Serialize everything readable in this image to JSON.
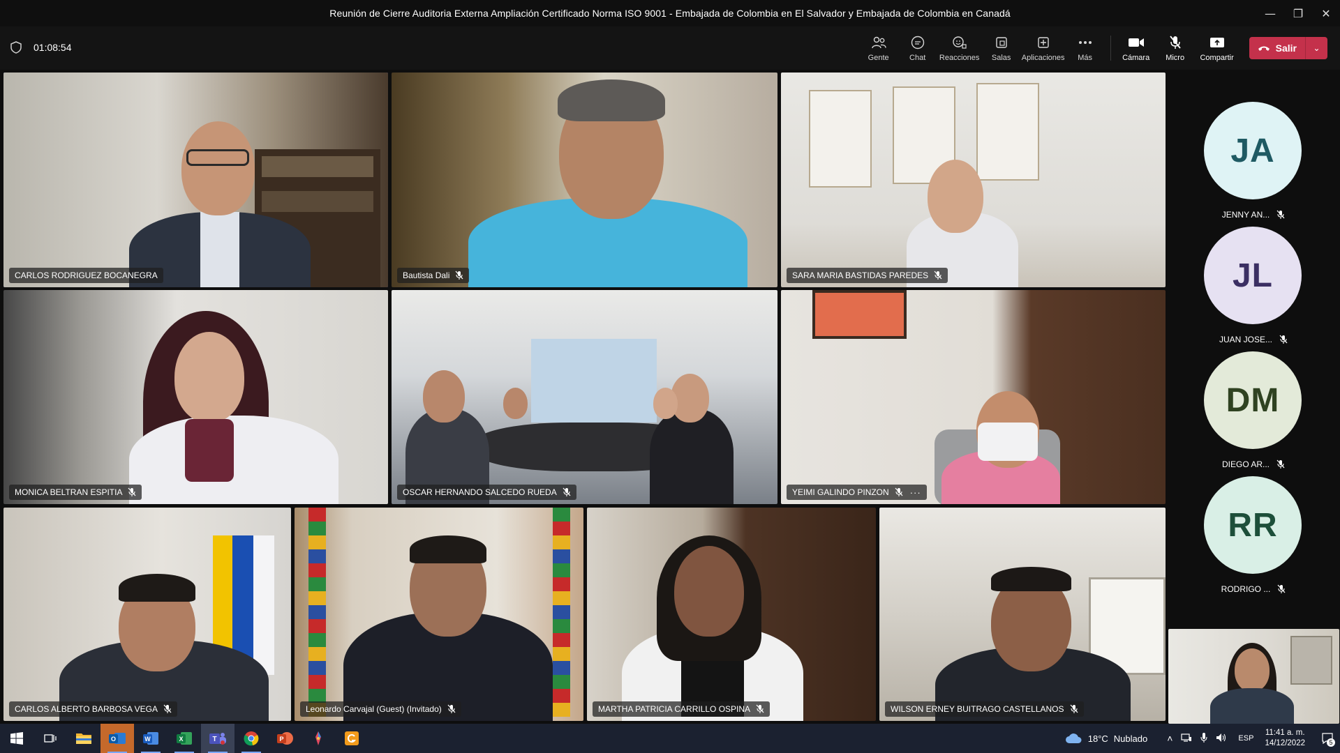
{
  "window": {
    "title": "Reunión de Cierre Auditoria Externa Ampliación Certificado Norma ISO 9001 - Embajada de Colombia en El Salvador y Embajada de Colombia en Canadá",
    "controls": [
      "minimize-icon",
      "restore-icon",
      "close-icon"
    ]
  },
  "toolbar": {
    "timer": "01:08:54",
    "items": [
      {
        "label": "Gente",
        "icon": "people-icon"
      },
      {
        "label": "Chat",
        "icon": "chat-icon"
      },
      {
        "label": "Reacciones",
        "icon": "reactions-icon"
      },
      {
        "label": "Salas",
        "icon": "rooms-icon"
      },
      {
        "label": "Aplicaciones",
        "icon": "apps-icon"
      },
      {
        "label": "Más",
        "icon": "more-icon"
      }
    ],
    "media": [
      {
        "label": "Cámara",
        "icon": "camera-icon"
      },
      {
        "label": "Micro",
        "icon": "mic-muted-icon"
      },
      {
        "label": "Compartir",
        "icon": "share-icon"
      }
    ],
    "leave_label": "Salir",
    "leave_color": "#c4314b"
  },
  "participants": [
    {
      "name": "CARLOS RODRIGUEZ BOCANEGRA",
      "muted": false,
      "active": true
    },
    {
      "name": "Bautista Dali",
      "muted": true
    },
    {
      "name": "SARA MARIA BASTIDAS PAREDES",
      "muted": true
    },
    {
      "name": "MONICA BELTRAN ESPITIA",
      "muted": true
    },
    {
      "name": "OSCAR HERNANDO SALCEDO RUEDA",
      "muted": true
    },
    {
      "name": "YEIMI GALINDO PINZON",
      "muted": true,
      "more": "···"
    },
    {
      "name": "CARLOS ALBERTO BARBOSA VEGA",
      "muted": true
    },
    {
      "name": "Leonardo Carvajal (Guest) (Invitado)",
      "muted": true
    },
    {
      "name": "MARTHA PATRICIA CARRILLO OSPINA",
      "muted": true
    },
    {
      "name": "WILSON ERNEY BUITRAGO CASTELLANOS",
      "muted": true
    }
  ],
  "rail": [
    {
      "initials": "JA",
      "name": "JENNY AN...",
      "bg": "#dff3f5",
      "fg": "#1f5a63"
    },
    {
      "initials": "JL",
      "name": "JUAN JOSE...",
      "bg": "#e6e1f2",
      "fg": "#3b2f63"
    },
    {
      "initials": "DM",
      "name": "DIEGO AR...",
      "bg": "#e3ead9",
      "fg": "#2f4221"
    },
    {
      "initials": "RR",
      "name": "RODRIGO ...",
      "bg": "#d9efe6",
      "fg": "#1d4f3a"
    }
  ],
  "taskbar": {
    "apps": [
      "windows-start-icon",
      "task-view-icon",
      "file-explorer-icon",
      "outlook-icon",
      "word-icon",
      "excel-icon",
      "teams-icon",
      "chrome-icon",
      "powerpoint-icon",
      "paint-icon",
      "app-orange-icon"
    ],
    "weather_temp": "18°C",
    "weather_text": "Nublado",
    "language": "ESP",
    "time": "11:41 a. m.",
    "date": "14/12/2022",
    "notifications": "5"
  }
}
